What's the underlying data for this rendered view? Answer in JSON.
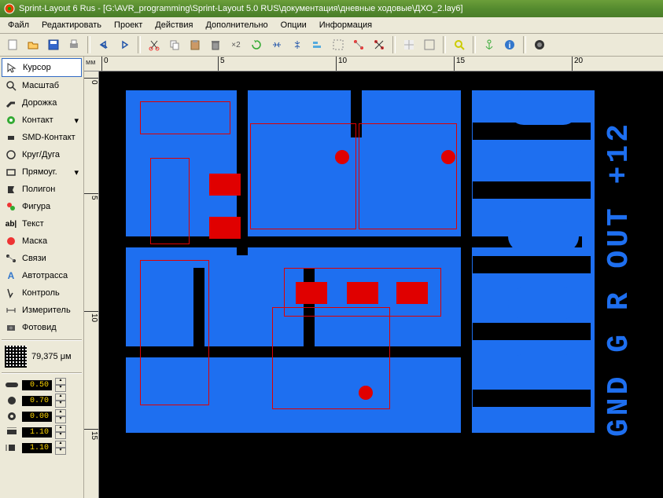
{
  "title": "Sprint-Layout 6 Rus - [G:\\AVR_programming\\Sprint-Layout 5.0 RUS\\документация\\дневные ходовые\\ДХО_2.lay6]",
  "menu": [
    "Файл",
    "Редактировать",
    "Проект",
    "Действия",
    "Дополнительно",
    "Опции",
    "Информация"
  ],
  "tools": [
    {
      "icon": "cursor",
      "label": "Курсор",
      "selected": true
    },
    {
      "icon": "zoom",
      "label": "Масштаб"
    },
    {
      "icon": "track",
      "label": "Дорожка"
    },
    {
      "icon": "contact",
      "label": "Контакт",
      "dropdown": true
    },
    {
      "icon": "smd",
      "label": "SMD-Контакт"
    },
    {
      "icon": "circle",
      "label": "Круг/Дуга"
    },
    {
      "icon": "rect",
      "label": "Прямоуг.",
      "dropdown": true
    },
    {
      "icon": "polygon",
      "label": "Полигон"
    },
    {
      "icon": "shape",
      "label": "Фигура"
    },
    {
      "icon": "text",
      "label": "Текст"
    },
    {
      "icon": "mask",
      "label": "Маска"
    },
    {
      "icon": "links",
      "label": "Связи"
    },
    {
      "icon": "auto",
      "label": "Автотрасса"
    },
    {
      "icon": "check",
      "label": "Контроль"
    },
    {
      "icon": "measure",
      "label": "Измеритель"
    },
    {
      "icon": "photo",
      "label": "Фотовид"
    }
  ],
  "grid_value": "79,375 μм",
  "params": [
    {
      "icon": "width",
      "value": "0.50"
    },
    {
      "icon": "pad-out",
      "value": "0.70"
    },
    {
      "icon": "pad-in",
      "value": "0.00"
    },
    {
      "icon": "smd-w",
      "value": "1.10"
    },
    {
      "icon": "smd-h",
      "value": "1.10"
    }
  ],
  "ruler": {
    "unit": "мм",
    "h_ticks": [
      {
        "pos": 22,
        "label": "0"
      },
      {
        "pos": 170,
        "label": "5"
      },
      {
        "pos": 320,
        "label": "10"
      },
      {
        "pos": 470,
        "label": "15"
      },
      {
        "pos": 620,
        "label": "20"
      }
    ],
    "v_ticks": [
      {
        "pos": 8,
        "label": "0"
      },
      {
        "pos": 155,
        "label": "5"
      },
      {
        "pos": 305,
        "label": "10"
      },
      {
        "pos": 455,
        "label": "15"
      }
    ]
  },
  "pcb_text": "GND G R OUT +12",
  "colors": {
    "copper": "#1e6ff0",
    "mask": "#e00000",
    "board": "#000"
  }
}
